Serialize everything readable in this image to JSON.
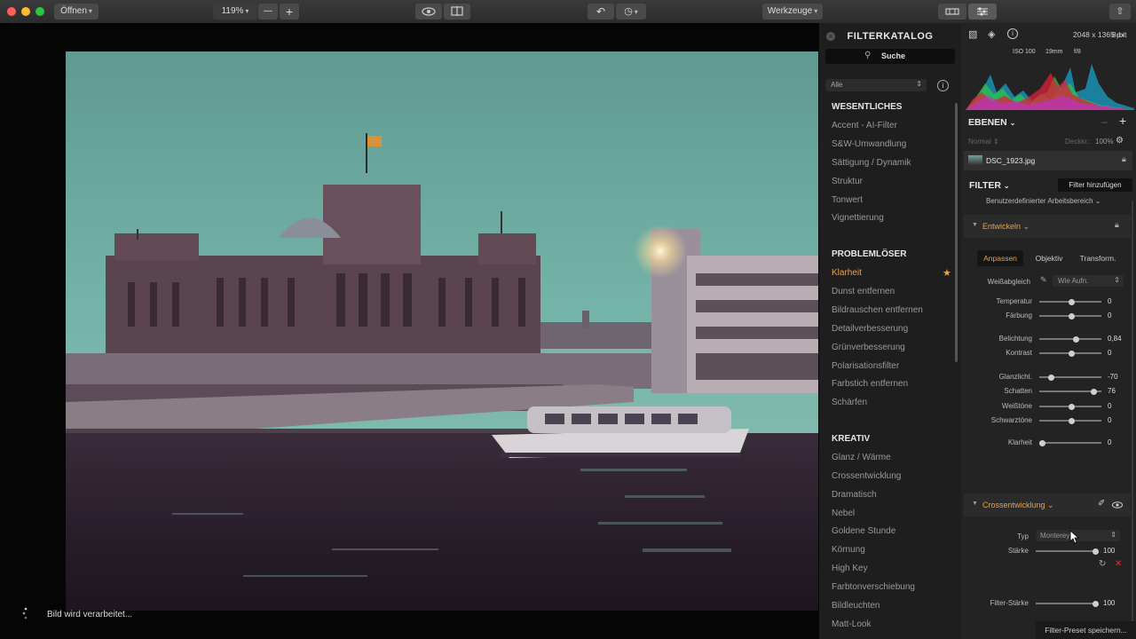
{
  "toolbar": {
    "open_label": "Öffnen",
    "zoom_value": "119%",
    "tools_label": "Werkzeuge"
  },
  "catalog": {
    "title": "FILTERKATALOG",
    "search_label": "Suche",
    "filter_select": "Alle",
    "sections": [
      {
        "title": "WESENTLICHES",
        "items": [
          "Accent - AI-Filter",
          "S&W-Umwandlung",
          "Sättigung / Dynamik",
          "Struktur",
          "Tonwert",
          "Vignettierung"
        ]
      },
      {
        "title": "PROBLEMLÖSER",
        "items": [
          "Klarheit",
          "Dunst entfernen",
          "Bildrauschen entfernen",
          "Detailverbesserung",
          "Grünverbesserung",
          "Polarisationsfilter",
          "Farbstich entfernen",
          "Schärfen"
        ]
      },
      {
        "title": "KREATIV",
        "items": [
          "Glanz / Wärme",
          "Crossentwicklung",
          "Dramatisch",
          "Nebel",
          "Goldene Stunde",
          "Körnung",
          "High Key",
          "Farbtonverschiebung",
          "Bildleuchten",
          "Matt-Look"
        ]
      }
    ],
    "active_item": "Klarheit"
  },
  "info": {
    "dimensions": "2048 x 1365 px",
    "bitdepth": "8-bit",
    "iso": "ISO 100",
    "focal": "19mm",
    "aperture": "f/8"
  },
  "layers": {
    "title": "EBENEN",
    "blend_mode": "Normal",
    "opacity_label": "Deckkr.:",
    "opacity_value": "100%",
    "layer_name": "DSC_1923.jpg"
  },
  "filter": {
    "title": "FILTER",
    "add_button": "Filter hinzufügen",
    "workspace": "Benutzerdefinierter Arbeitsbereich"
  },
  "develop": {
    "title": "Entwickeln",
    "tabs": [
      "Anpassen",
      "Objektiv",
      "Transform."
    ],
    "wb_label": "Weißabgleich",
    "wb_value": "Wie Aufn.",
    "sliders": [
      {
        "label": "Temperatur",
        "value": "0",
        "pos": 0.5
      },
      {
        "label": "Färbung",
        "value": "0",
        "pos": 0.5
      },
      {
        "label": "Belichtung",
        "value": "0,84",
        "pos": 0.57
      },
      {
        "label": "Kontrast",
        "value": "0",
        "pos": 0.5
      },
      {
        "label": "Glanzlicht.",
        "value": "-70",
        "pos": 0.15
      },
      {
        "label": "Schatten",
        "value": "76",
        "pos": 0.88
      },
      {
        "label": "Weißtöne",
        "value": "0",
        "pos": 0.5
      },
      {
        "label": "Schwarztöne",
        "value": "0",
        "pos": 0.5
      },
      {
        "label": "Klarheit",
        "value": "0",
        "pos": 0.0
      }
    ]
  },
  "cross": {
    "title": "Crossentwicklung",
    "type_label": "Typ",
    "type_value": "Monterey",
    "strength_label": "Stärke",
    "strength_value": "100",
    "filter_strength_label": "Filter-Stärke",
    "filter_strength_value": "100",
    "save_preset": "Filter-Preset speichern..."
  },
  "status": {
    "processing": "Bild wird verarbeitet..."
  }
}
